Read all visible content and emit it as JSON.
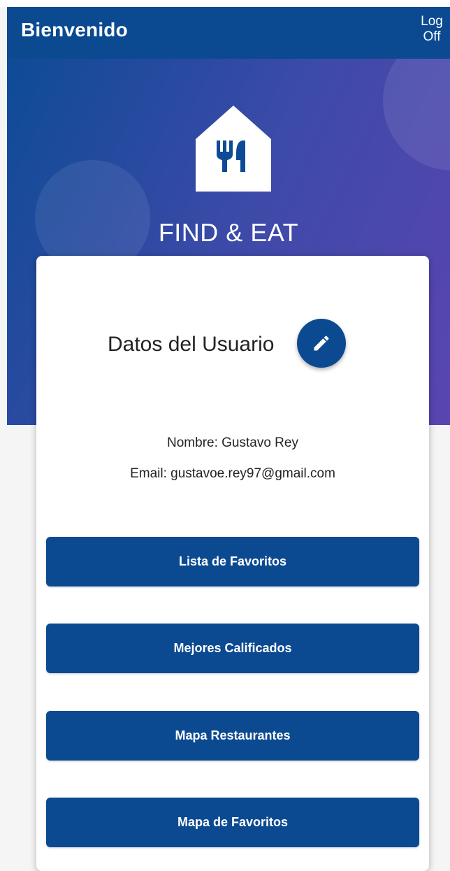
{
  "app_bar": {
    "title": "Bienvenido",
    "logoff_line1": "Log",
    "logoff_line2": "Off"
  },
  "hero": {
    "app_name": "FIND & EAT",
    "logo_icon": "house-cutlery-icon"
  },
  "user_card": {
    "title": "Datos del Usuario",
    "edit_icon": "pencil-icon",
    "name_line": "Nombre: Gustavo Rey",
    "email_line": "Email: gustavoe.rey97@gmail.com"
  },
  "menu": {
    "buttons": [
      {
        "label": "Lista de Favoritos"
      },
      {
        "label": "Mejores Calificados"
      },
      {
        "label": "Mapa Restaurantes"
      },
      {
        "label": "Mapa de Favoritos"
      }
    ]
  },
  "colors": {
    "primary": "#0b4a91",
    "hero_gradient_start": "#0e4b96",
    "hero_gradient_end": "#5a45b0",
    "background": "#f5f5f5",
    "card": "#ffffff"
  }
}
